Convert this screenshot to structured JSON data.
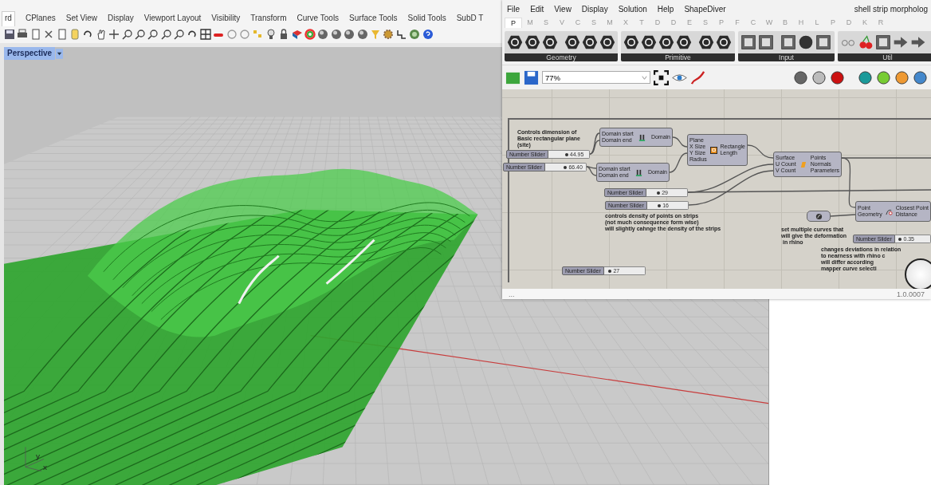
{
  "rhino": {
    "tabs": [
      {
        "label": "rd",
        "selected": true
      },
      {
        "label": "CPlanes",
        "selected": false
      },
      {
        "label": "Set View",
        "selected": false
      },
      {
        "label": "Display",
        "selected": false
      },
      {
        "label": "Viewport Layout",
        "selected": false
      },
      {
        "label": "Visibility",
        "selected": false
      },
      {
        "label": "Transform",
        "selected": false
      },
      {
        "label": "Curve Tools",
        "selected": false
      },
      {
        "label": "Surface Tools",
        "selected": false
      },
      {
        "label": "Solid Tools",
        "selected": false
      },
      {
        "label": "SubD T",
        "selected": false
      }
    ],
    "viewport": {
      "label": "Perspective",
      "axis": {
        "y": "y",
        "x": "x"
      }
    }
  },
  "grasshopper": {
    "menu": [
      "File",
      "Edit",
      "View",
      "Display",
      "Solution",
      "Help",
      "ShapeDiver"
    ],
    "title": "shell strip morpholog",
    "tabs": [
      {
        "label": "P",
        "selected": true
      },
      {
        "label": "M",
        "selected": false
      },
      {
        "label": "S",
        "selected": false
      },
      {
        "label": "V",
        "selected": false
      },
      {
        "label": "C",
        "selected": false
      },
      {
        "label": "S",
        "selected": false
      },
      {
        "label": "M",
        "selected": false
      },
      {
        "label": "X",
        "selected": false
      },
      {
        "label": "T",
        "selected": false
      },
      {
        "label": "D",
        "selected": false
      },
      {
        "label": "D",
        "selected": false
      },
      {
        "label": "E",
        "selected": false
      },
      {
        "label": "S",
        "selected": false
      },
      {
        "label": "P",
        "selected": false
      },
      {
        "label": "F",
        "selected": false
      },
      {
        "label": "C",
        "selected": false
      },
      {
        "label": "W",
        "selected": false
      },
      {
        "label": "B",
        "selected": false
      },
      {
        "label": "H",
        "selected": false
      },
      {
        "label": "L",
        "selected": false
      },
      {
        "label": "P",
        "selected": false
      },
      {
        "label": "D",
        "selected": false
      },
      {
        "label": "K",
        "selected": false
      },
      {
        "label": "R",
        "selected": false
      }
    ],
    "ribbon_groups": [
      "Geometry",
      "Primitive",
      "Input",
      "Util"
    ],
    "zoom": "77%",
    "canvas": {
      "notes": [
        "Controls dimension of\nBasic rectangular plane\n(site)",
        "controls density of points on strips\n(not much consequence form wise)\nwill slightly cahnge the density of the strips",
        "set multiple curves that\nwill give the deformation\n in rhino",
        "changes deviations in relation\nto nearness with rhino c\nwill differ according\nmapper curve selecti"
      ],
      "sliders": [
        {
          "label": "Number Slider",
          "value": "44.95",
          "level": 0.45
        },
        {
          "label": "Number Slider",
          "value": "66.40",
          "level": 0.5
        },
        {
          "label": "Number Slider",
          "value": "29",
          "level": 0.3
        },
        {
          "label": "Number Slider",
          "value": "16",
          "level": 0.3
        },
        {
          "label": "Number Slider",
          "value": "0.35",
          "level": 0.15
        },
        {
          "label": "Number Slider",
          "value": "27",
          "level": 0.15
        }
      ],
      "components": [
        {
          "kind": "domain",
          "inputs": [
            "Domain start",
            "Domain end"
          ],
          "outputs": [
            "Domain"
          ]
        },
        {
          "kind": "domain",
          "inputs": [
            "Domain start",
            "Domain end"
          ],
          "outputs": [
            "Domain"
          ]
        },
        {
          "kind": "rectangle",
          "inputs": [
            "Plane",
            "X Size",
            "Y Size",
            "Radius"
          ],
          "outputs": [
            "Rectangle",
            "Length"
          ]
        },
        {
          "kind": "surface-points",
          "inputs": [
            "Surface",
            "U Count",
            "V Count"
          ],
          "outputs": [
            "Points",
            "Normals",
            "Parameters"
          ]
        },
        {
          "kind": "closest-point",
          "inputs": [
            "Point",
            "Geometry"
          ],
          "outputs": [
            "Closest Point",
            "Distance"
          ]
        },
        {
          "kind": "curve-param"
        }
      ]
    },
    "status": "...",
    "version": "1.0.0007"
  }
}
